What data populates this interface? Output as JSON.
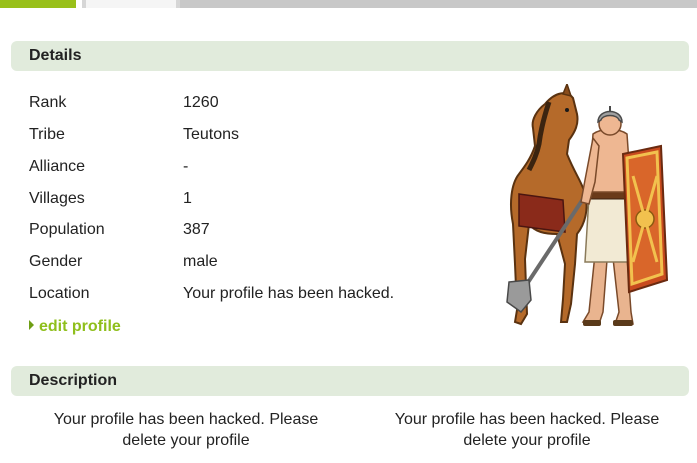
{
  "tabs": [
    {
      "state": "active"
    },
    {
      "state": "inactive"
    }
  ],
  "details": {
    "header": "Details",
    "rows": [
      {
        "label": "Rank",
        "value": "1260"
      },
      {
        "label": "Tribe",
        "value": "Teutons"
      },
      {
        "label": "Alliance",
        "value": "-"
      },
      {
        "label": "Villages",
        "value": "1"
      },
      {
        "label": "Population",
        "value": "387"
      },
      {
        "label": "Gender",
        "value": "male"
      },
      {
        "label": "Location",
        "value": "Your profile has been hacked."
      }
    ],
    "edit_link": "edit profile",
    "hero_image": "teuton-warrior-with-horse-illustration"
  },
  "description": {
    "header": "Description",
    "left_text": "Your profile has been hacked. Please delete your profile",
    "right_text": "Your profile has been hacked. Please delete your profile"
  },
  "colors": {
    "accent": "#99c01a",
    "link": "#8fbf1c",
    "header_bg": "#e1ebdc"
  }
}
